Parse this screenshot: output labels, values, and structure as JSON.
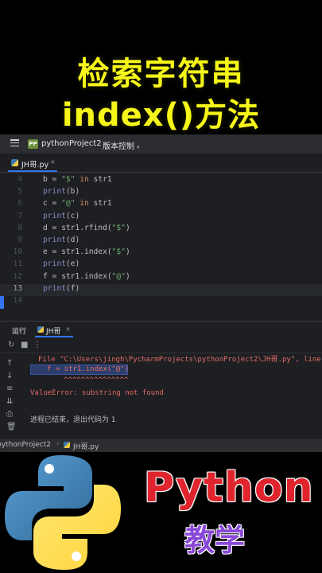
{
  "overlay": {
    "title_line1": "检索字符串",
    "title_line2": "index()方法"
  },
  "ide": {
    "topbar": {
      "project_badge": "PP",
      "project_name": "pythonProject2",
      "vcs_label": "版本控制"
    },
    "editor_tab": {
      "file_name": "JH哥.py",
      "close": "×"
    },
    "lines": [
      {
        "num": "4",
        "code": "b = \"$\" in str1"
      },
      {
        "num": "5",
        "code": "print(b)"
      },
      {
        "num": "6",
        "code": "c = \"@\" in str1"
      },
      {
        "num": "7",
        "code": "print(c)"
      },
      {
        "num": "8",
        "code": "d = str1.rfind(\"$\")"
      },
      {
        "num": "9",
        "code": "print(d)"
      },
      {
        "num": "10",
        "code": "e = str1.index(\"$\")"
      },
      {
        "num": "11",
        "code": "print(e)"
      },
      {
        "num": "12",
        "code": "f = str1.index(\"@\")"
      },
      {
        "num": "13",
        "code": "print(f)"
      },
      {
        "num": "14",
        "code": ""
      }
    ],
    "run_panel": {
      "label": "运行",
      "tab_name": "JH哥",
      "close": "×"
    },
    "console": {
      "error_path": "File \"C:\\Users\\jingh\\PycharmProjects\\pythonProject2\\JH哥.py\", line",
      "error_code": "f = str1.index(\"@\")",
      "carets": "^^^^^^^^^^^^^^^",
      "error_message": "ValueError: substring not found",
      "exit_message": "进程已结束，退出代码为 1"
    },
    "status_bar": {
      "project": "pythonProject2",
      "separator": "›",
      "file": "JH哥.py"
    }
  },
  "branding": {
    "word": "Python",
    "subtitle": "教学"
  },
  "colors": {
    "title_yellow": "#f6f61a",
    "python_red": "#e0242d",
    "teach_purple": "#8a49d8",
    "accent_blue": "#3574f0",
    "error_red": "#e06c66"
  }
}
